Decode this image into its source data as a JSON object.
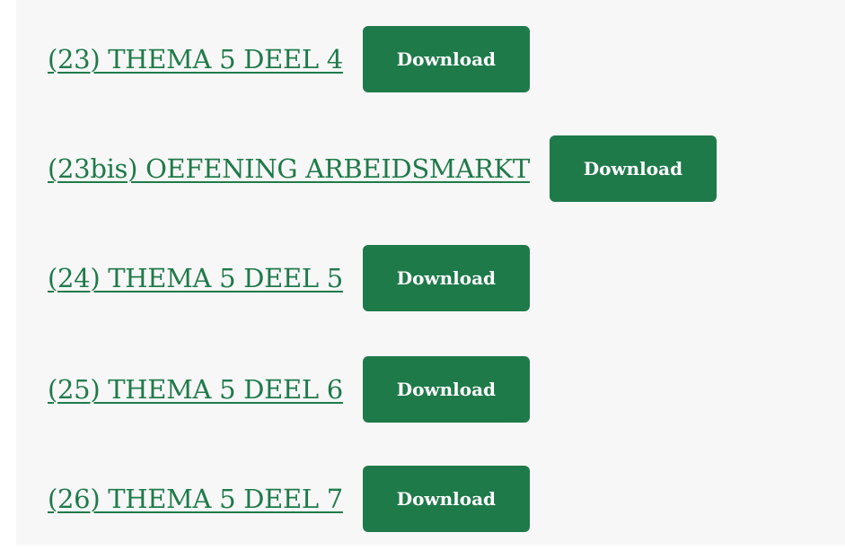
{
  "downloads": [
    {
      "title": "(23) THEMA 5 DEEL 4",
      "button": "Download"
    },
    {
      "title": "(23bis) OEFENING ARBEIDSMARKT",
      "button": "Download"
    },
    {
      "title": "(24) THEMA 5 DEEL 5",
      "button": "Download"
    },
    {
      "title": "(25) THEMA 5 DEEL 6",
      "button": "Download"
    },
    {
      "title": "(26) THEMA 5 DEEL 7",
      "button": "Download"
    }
  ],
  "colors": {
    "accent": "#1f7a4a",
    "panel_bg": "#f7f7f7",
    "button_text": "#ffffff"
  }
}
